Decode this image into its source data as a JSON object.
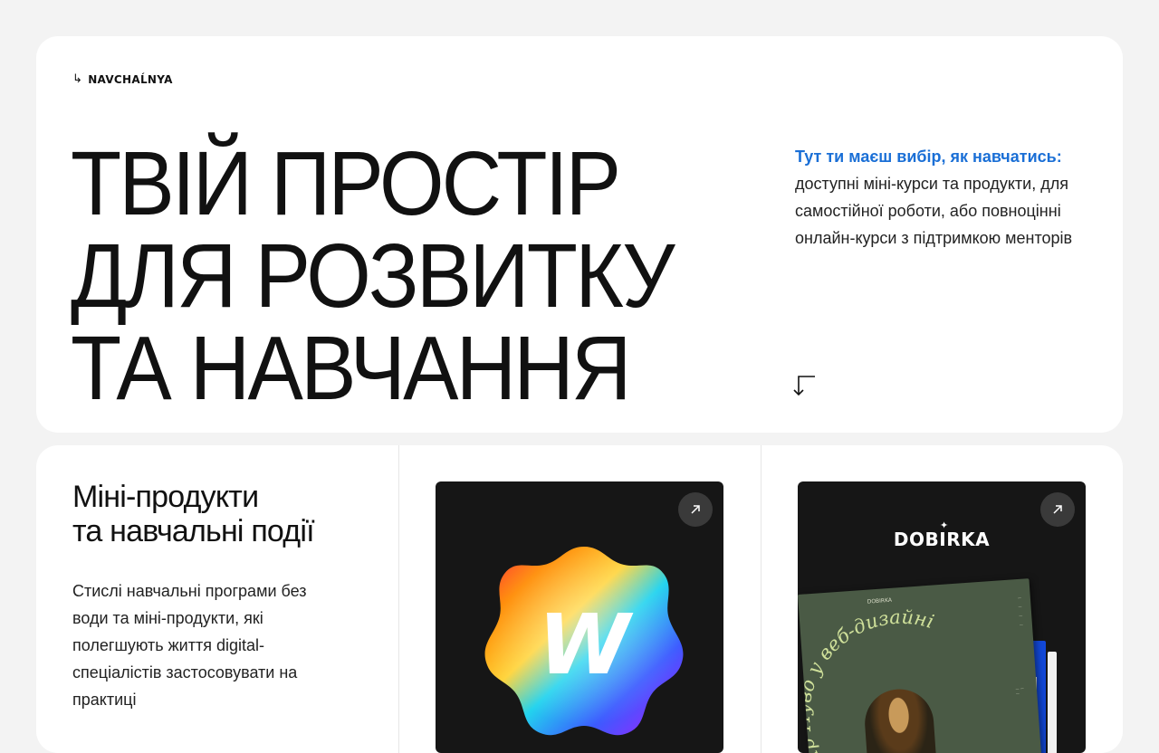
{
  "brand": {
    "arrow": "↳",
    "name": "NAVCHAĹNYA"
  },
  "hero": {
    "headline_lines": [
      "ТВІЙ ПРОСТІР",
      "ДЛЯ РОЗВИТКУ",
      "ТА НАВЧАННЯ"
    ],
    "intro_accent": "Тут ти маєш вибір, як навчатись:",
    "intro_text": "доступні міні-курси та продукти, для самостійної роботи, або повноцінні онлайн-курси з підтримкою менторів",
    "scroll_icon": "arrow-down-left-icon"
  },
  "products": {
    "title_lines": [
      "Міні-продукти",
      "та навчальні події"
    ],
    "description": "Стислі навчальні програми без води та міні-продукти, які полегшують життя digital-спеціалістів застосовувати на практиці",
    "cards": [
      {
        "icon": "webflow-badge-icon",
        "badge_letter": "W",
        "link_icon": "arrow-up-right-icon"
      },
      {
        "logo": "DOBIRKA",
        "logo_star": "✦",
        "poster_brand": "DOBIRKA",
        "poster_title": "Ар Нуво у веб-дизайні",
        "link_icon": "arrow-up-right-icon"
      }
    ]
  },
  "colors": {
    "accent": "#1a6fd6",
    "card_bg": "#161616",
    "page_bg": "#f3f3f3"
  }
}
